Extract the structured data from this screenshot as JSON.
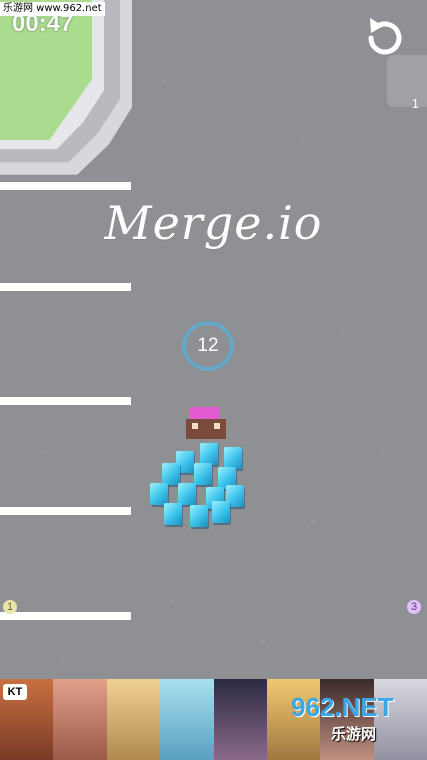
{
  "watermark": "乐游网 www.962.net",
  "timer": "00:47",
  "title": "Merge.io",
  "crowd_count": "12",
  "side_numbers": {
    "right_top": "1",
    "left_bottom": "1",
    "right_bottom": "3"
  },
  "ad": {
    "logo": "KT",
    "brand_main": "962.NET",
    "brand_sub": "乐游网"
  },
  "icons": {
    "restart": "restart-icon"
  },
  "colors": {
    "ground": "#8f9094",
    "grass": "#a9dc8e",
    "crowd": "#3cc2ea",
    "leader_hair": "#e25ad0",
    "count_ring": "#66a8c9"
  }
}
